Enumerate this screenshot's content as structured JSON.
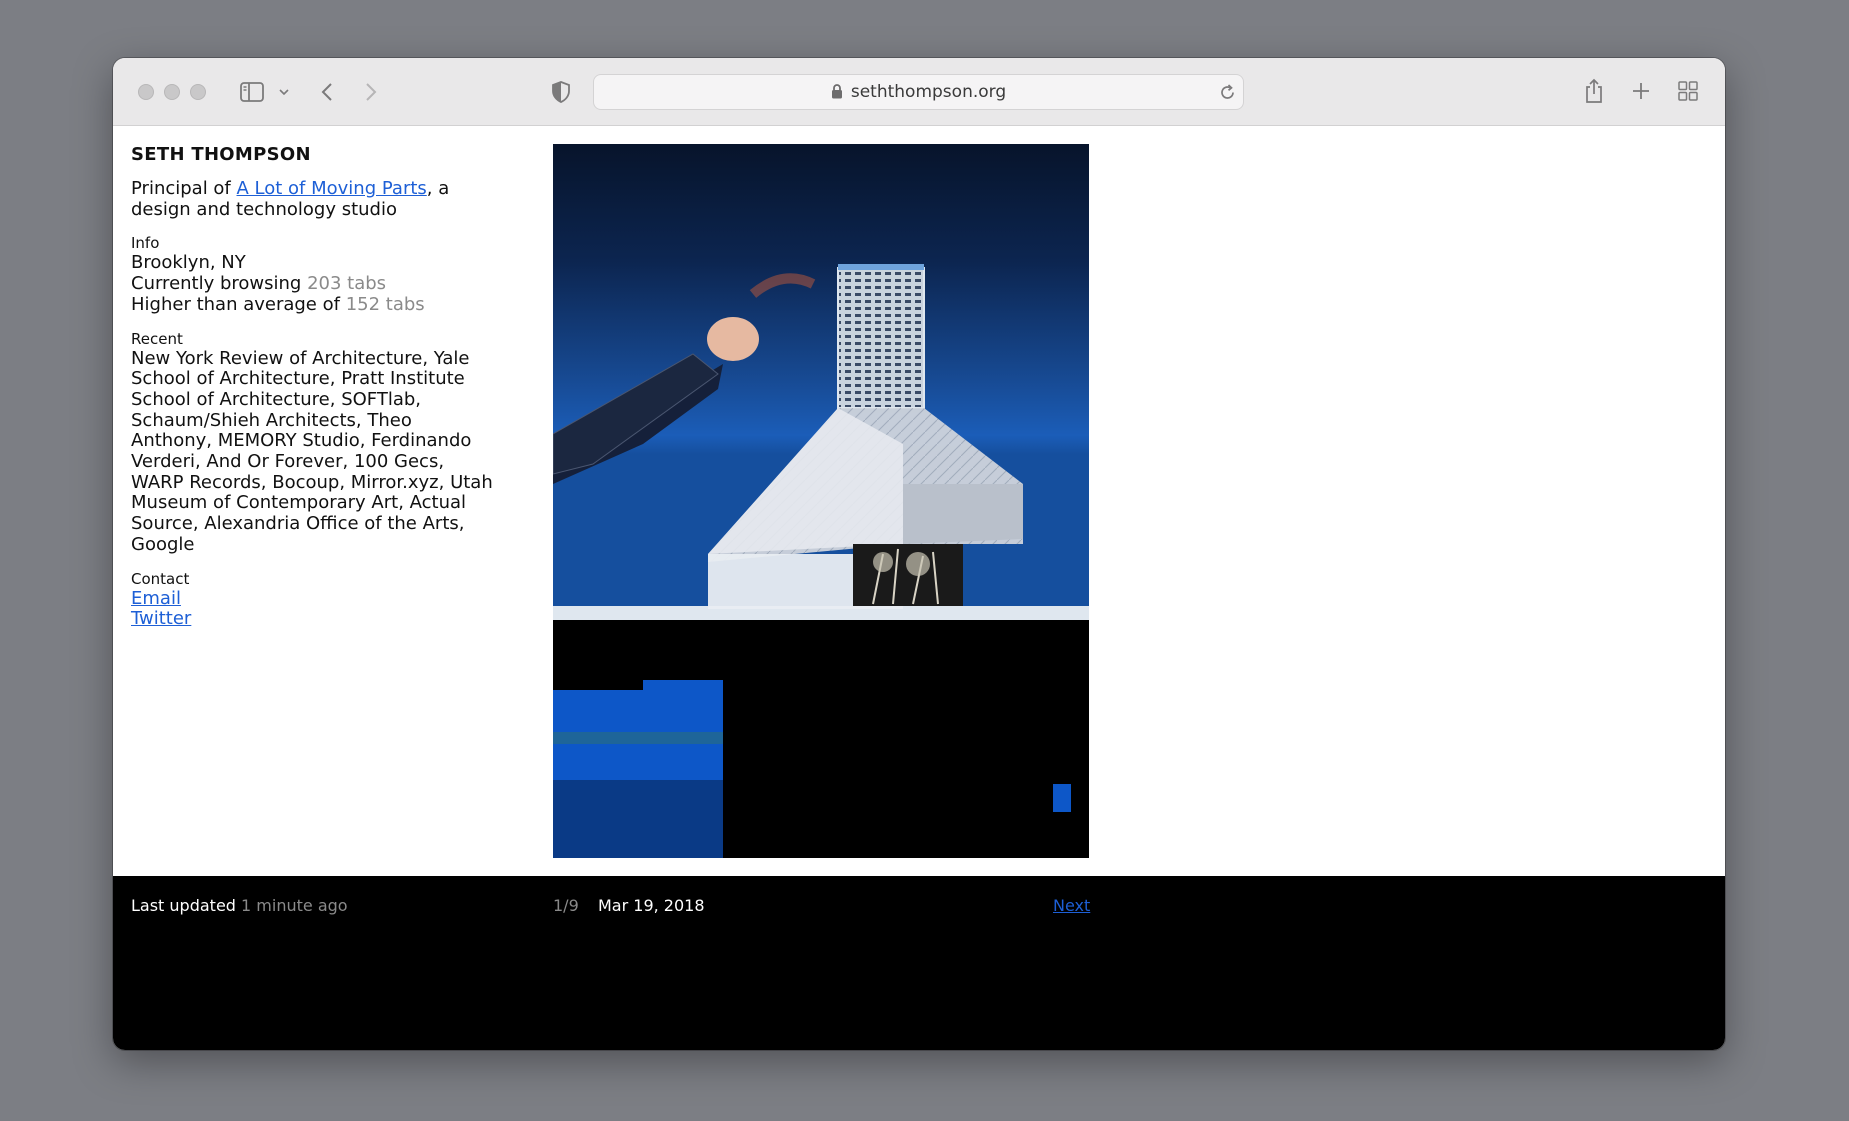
{
  "browser": {
    "url_host": "seththompson.org"
  },
  "profile": {
    "name": "SETH THOMPSON",
    "intro_prefix": "Principal of ",
    "intro_link": "A Lot of Moving Parts",
    "intro_suffix": ", a design and technology studio",
    "info_label": "Info",
    "location": "Brooklyn, NY",
    "browsing_prefix": "Currently browsing ",
    "browsing_value": "203 tabs",
    "average_prefix": "Higher than average of ",
    "average_value": "152 tabs",
    "recent_label": "Recent",
    "recent_text": "New York Review of Architecture, Yale School of Architecture, Pratt Institute School of Architecture, SOFTlab, Schaum/Shieh Architects, Theo Anthony, MEMORY Studio, Ferdinando Verderi, And Or Forever, 100 Gecs, WARP Records, Bocoup, Mirror.xyz, Utah Museum of Contemporary Art, Actual Source, Alexandria Office of the Arts, Google",
    "contact_label": "Contact",
    "email_link": "Email",
    "twitter_link": "Twitter"
  },
  "footer": {
    "updated_prefix": "Last updated ",
    "updated_value": "1 minute ago",
    "counter": "1/9",
    "date": "Mar 19, 2018",
    "next_link": "Next"
  },
  "colors": {
    "link": "#1d5fd6",
    "muted": "#8a8a8a",
    "footer_bg": "#000000"
  }
}
